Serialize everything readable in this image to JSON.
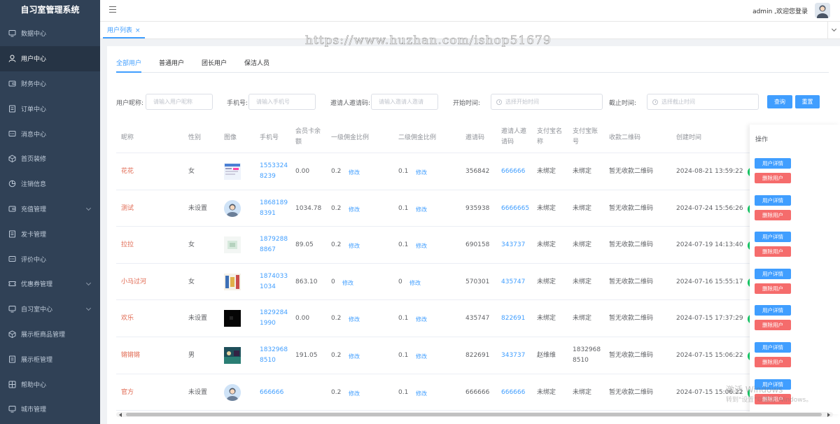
{
  "app": {
    "title": "自习室管理系统",
    "welcome": "admin ,欢迎您登录"
  },
  "sidebar": {
    "items": [
      {
        "label": "数据中心",
        "icon": "monitor-icon",
        "expandable": false
      },
      {
        "label": "用户中心",
        "icon": "user-icon",
        "expandable": false,
        "active": true
      },
      {
        "label": "财务中心",
        "icon": "wallet-icon",
        "expandable": false
      },
      {
        "label": "订单中心",
        "icon": "document-icon",
        "expandable": false
      },
      {
        "label": "消息中心",
        "icon": "message-icon",
        "expandable": false
      },
      {
        "label": "首页装修",
        "icon": "box-icon",
        "expandable": false
      },
      {
        "label": "注销信息",
        "icon": "pie-chart-icon",
        "expandable": false
      },
      {
        "label": "充值管理",
        "icon": "wallet-icon",
        "expandable": true
      },
      {
        "label": "发卡管理",
        "icon": "document-icon",
        "expandable": false
      },
      {
        "label": "评价中心",
        "icon": "message-icon",
        "expandable": false
      },
      {
        "label": "优惠券管理",
        "icon": "ticket-icon",
        "expandable": true
      },
      {
        "label": "自习室中心",
        "icon": "monitor-icon",
        "expandable": true
      },
      {
        "label": "展示柜商品管理",
        "icon": "box-icon",
        "expandable": false
      },
      {
        "label": "展示柜管理",
        "icon": "document-icon",
        "expandable": false
      },
      {
        "label": "帮助中心",
        "icon": "grid-icon",
        "expandable": false
      },
      {
        "label": "城市管理",
        "icon": "monitor-icon",
        "expandable": false
      }
    ]
  },
  "tabs_bar": {
    "active_tab": "用户列表",
    "close": "×"
  },
  "watermark": "https://www.huzhan.com/ishop51679",
  "subtabs": [
    "全部用户",
    "普通用户",
    "团长用户",
    "保洁人员"
  ],
  "filters": {
    "nickname_label": "用户昵称:",
    "nickname_placeholder": "请输入用户昵称",
    "phone_label": "手机号:",
    "phone_placeholder": "请输入手机号",
    "invite_label": "邀请人邀请码:",
    "invite_placeholder": "请输入邀请人邀请",
    "start_label": "开始时间:",
    "start_placeholder": "选择开始时间",
    "end_label": "截止时间:",
    "end_placeholder": "选择截止时间",
    "query_btn": "查询",
    "reset_btn": "重置"
  },
  "table": {
    "headers": {
      "nickname": "昵称",
      "gender": "性别",
      "image": "图像",
      "phone": "手机号",
      "balance_1": "会员卡余",
      "balance_2": "额",
      "commission1": "一级佣金比例",
      "commission2": "二级佣金比例",
      "invite_code": "邀请码",
      "inviter_1": "邀请人邀",
      "inviter_2": "请码",
      "alipay_name_1": "支付宝名",
      "alipay_name_2": "称",
      "alipay_acct_1": "支付宝账",
      "alipay_acct_2": "号",
      "qrcode": "收款二维码",
      "created": "创建时间",
      "ops": "操作"
    },
    "modify": "修改",
    "detail_btn": "用户详情",
    "delete_btn": "删除用户",
    "rows": [
      {
        "nickname": "花花",
        "gender": "女",
        "img": "screenshot",
        "phone1": "1553324",
        "phone2": "8239",
        "balance": "0.00",
        "c1": "0.2",
        "c2": "0.1",
        "code": "356842",
        "inviter": "666666",
        "ali_name": "未绑定",
        "ali_acct1": "未绑定",
        "ali_acct2": "",
        "qr": "暂无收款二维码",
        "created": "2024-08-21 13:59:22"
      },
      {
        "nickname": "测试",
        "gender": "未设置",
        "img": "default",
        "phone1": "1868189",
        "phone2": "8391",
        "balance": "1034.78",
        "c1": "0.2",
        "c2": "0.1",
        "code": "935938",
        "inviter": "6666665",
        "ali_name": "未绑定",
        "ali_acct1": "未绑定",
        "ali_acct2": "",
        "qr": "暂无收款二维码",
        "created": "2024-07-24 15:56:26"
      },
      {
        "nickname": "拉拉",
        "gender": "女",
        "img": "light",
        "phone1": "1879288",
        "phone2": "8867",
        "balance": "89.05",
        "c1": "0.2",
        "c2": "0.1",
        "code": "690158",
        "inviter": "343737",
        "ali_name": "未绑定",
        "ali_acct1": "未绑定",
        "ali_acct2": "",
        "qr": "暂无收款二维码",
        "created": "2024-07-19 14:13:40"
      },
      {
        "nickname": "小马过河",
        "gender": "女",
        "img": "colorful",
        "phone1": "1874033",
        "phone2": "1034",
        "balance": "863.10",
        "c1": "0",
        "c2": "0",
        "code": "570301",
        "inviter": "435747",
        "ali_name": "未绑定",
        "ali_acct1": "未绑定",
        "ali_acct2": "",
        "qr": "暂无收款二维码",
        "created": "2024-07-16 15:55:17"
      },
      {
        "nickname": "欢乐",
        "gender": "未设置",
        "img": "dark",
        "phone1": "1829284",
        "phone2": "1990",
        "balance": "0.00",
        "c1": "0.2",
        "c2": "0.1",
        "code": "435747",
        "inviter": "822691",
        "ali_name": "未绑定",
        "ali_acct1": "未绑定",
        "ali_acct2": "",
        "qr": "暂无收款二维码",
        "created": "2024-07-15 17:37:29"
      },
      {
        "nickname": "锵锵锵",
        "gender": "男",
        "img": "scene",
        "phone1": "1832968",
        "phone2": "8510",
        "balance": "191.05",
        "c1": "0.2",
        "c2": "0.1",
        "code": "822691",
        "inviter": "343737",
        "ali_name": "赵维维",
        "ali_acct1": "1832968",
        "ali_acct2": "8510",
        "qr": "暂无收款二维码",
        "created": "2024-07-15 15:06:22"
      },
      {
        "nickname": "官方",
        "gender": "未设置",
        "img": "default",
        "phone1": "666666",
        "phone2": "",
        "balance": "",
        "c1": "0.2",
        "c2": "0.1",
        "code": "666666",
        "inviter": "666666",
        "ali_name": "未绑定",
        "ali_acct1": "未绑定",
        "ali_acct2": "",
        "qr": "暂无收款二维码",
        "created": "2024-07-15 15:06:22"
      }
    ]
  },
  "os_watermark": {
    "line1": "激活 Windows",
    "line2": "转到\"设置\"以激活 Windows。"
  },
  "colors": {
    "sidebar_bg": "#304156",
    "primary": "#409eff",
    "danger": "#f56c6c",
    "nickname_red": "#e0674f",
    "status_green": "#13ce66"
  }
}
